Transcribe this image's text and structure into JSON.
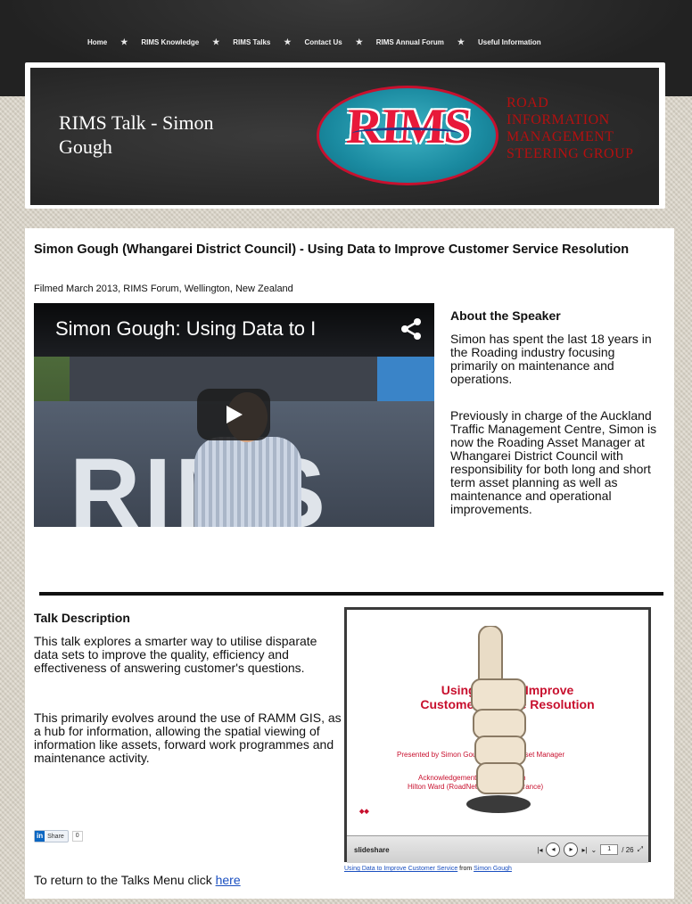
{
  "nav": {
    "items": [
      "Home",
      "RIMS Knowledge",
      "RIMS Talks",
      "Contact Us",
      "RIMS Annual Forum",
      "Useful Information"
    ],
    "separator": "★"
  },
  "banner": {
    "title": "RIMS Talk - Simon Gough",
    "logo_text": "RIMS",
    "org_lines": [
      "ROAD",
      "INFORMATION",
      "MANAGEMENT",
      "STEERING GROUP"
    ]
  },
  "talk": {
    "title": "Simon Gough (Whangarei District Council) - Using Data to Improve Customer Service Resolution",
    "filmed": "Filmed March 2013, RIMS Forum, Wellington, New Zealand"
  },
  "video": {
    "title": "Simon Gough: Using Data to I",
    "stage_letters": "RIMS"
  },
  "about": {
    "heading": "About the Speaker",
    "p1": "Simon has spent the last 18 years in the Roading industry focusing primarily on maintenance and operations.",
    "p2": "Previously in charge of the Auckland Traffic Management Centre, Simon is now the Roading Asset Manager at Whangarei District Council with responsibility for both long and short term asset planning as well as maintenance and operational improvements."
  },
  "description": {
    "heading": "Talk Description",
    "p1": "This talk explores a smarter way to utilise disparate data sets to improve the quality, efficiency and effectiveness of answering customer's questions.",
    "p2": "This primarily evolves around the use of RAMM GIS, as a hub for information, allowing the spatial viewing of information like assets, forward work programmes and maintenance activity."
  },
  "share": {
    "button_label": "Share",
    "count": "0"
  },
  "return": {
    "text": "To return to the Talks Menu click ",
    "link": "here"
  },
  "slideshare": {
    "slide_title_1": "Using Data to Improve",
    "slide_title_2": "Customer Service Resolution",
    "presented_by": "Presented by Simon Gough, Roading Asset Manager",
    "ack_line_1": "Acknowledgement to presentation",
    "ack_line_2": "Hilton Ward (RoadNet Roading Assurance)",
    "brand": "slideshare",
    "page_current": "1",
    "page_total": "/ 26",
    "caption_link": "Using Data to Improve Customer Service",
    "caption_mid": " from ",
    "caption_author": "Simon Gough"
  },
  "colors": {
    "accent_red": "#c8102e",
    "link_blue": "#1a4fc0",
    "header_dark": "#2a2a2a"
  }
}
